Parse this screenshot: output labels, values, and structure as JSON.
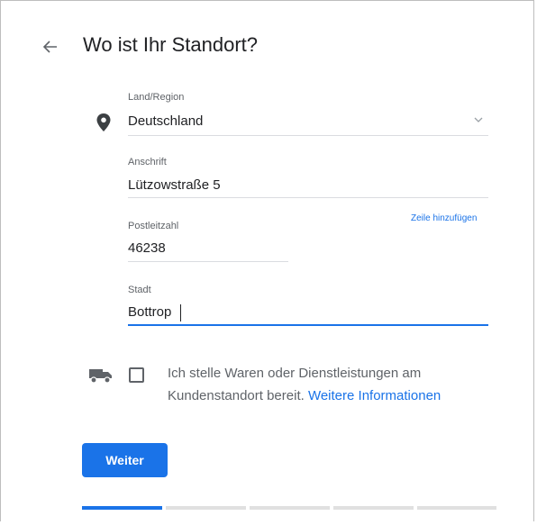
{
  "page": {
    "title": "Wo ist Ihr Standort?"
  },
  "country": {
    "label": "Land/Region",
    "value": "Deutschland"
  },
  "address": {
    "label": "Anschrift",
    "value": "Lützowstraße 5"
  },
  "add_line_link": "Zeile hinzufügen",
  "postal_code": {
    "label": "Postleitzahl",
    "value": "46238"
  },
  "city": {
    "label": "Stadt",
    "value": "Bottrop"
  },
  "service_area": {
    "checked": false,
    "text": "Ich stelle Waren oder Dienstleistungen am Kundenstandort bereit.",
    "link": "Weitere Informationen"
  },
  "next_button": "Weiter",
  "progress": {
    "steps": 5,
    "completed": 1
  },
  "colors": {
    "accent": "#1a73e8",
    "text": "#202124",
    "secondary_text": "#5f6368",
    "divider": "#dadce0"
  },
  "icons": [
    "back-arrow-icon",
    "location-pin-icon",
    "chevron-down-icon",
    "truck-icon"
  ]
}
